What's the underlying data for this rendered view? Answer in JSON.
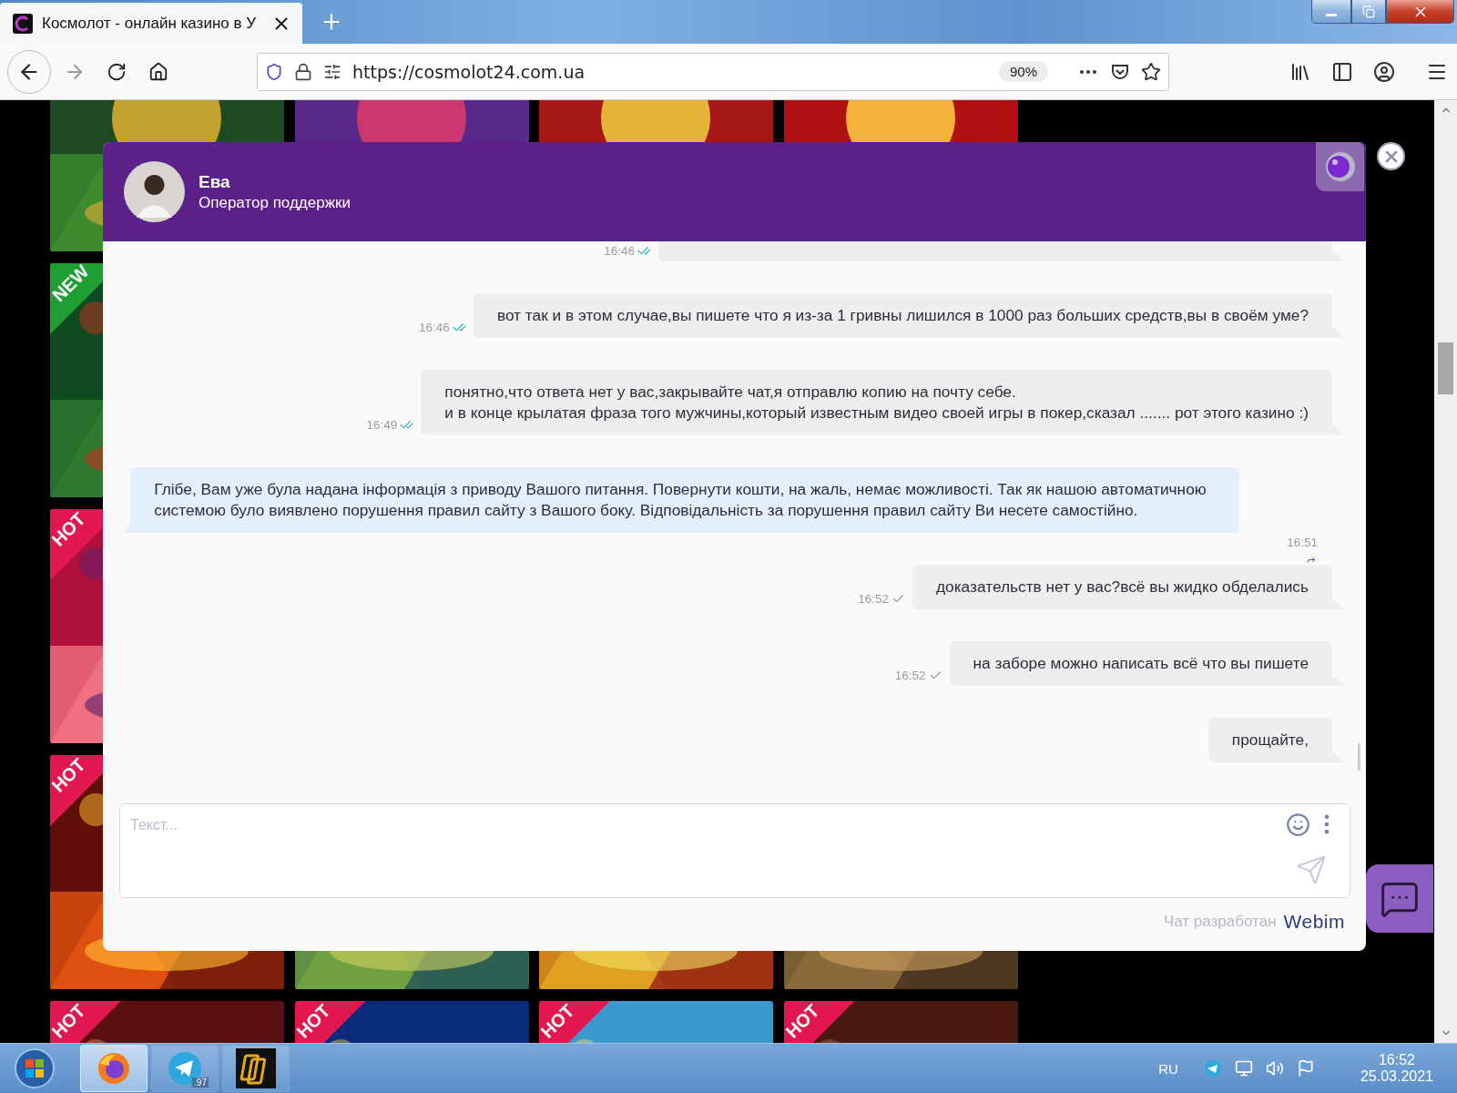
{
  "browser": {
    "tab": {
      "title": "Космолот - онлайн казино в У",
      "selected": true
    },
    "address": {
      "url": "https://cosmolot24.com.ua",
      "zoom": "90%"
    }
  },
  "games": [
    [
      {
        "kind": "picture"
      },
      {
        "kind": "picture"
      },
      {
        "kind": "picture"
      },
      {
        "kind": "picture"
      }
    ],
    [
      {
        "kind": "picture",
        "badge": {
          "text": "NEW",
          "color": "#1f9e34"
        }
      },
      {
        "kind": "covered"
      },
      {
        "kind": "covered"
      },
      {
        "kind": "covered"
      }
    ],
    [
      {
        "kind": "picture",
        "badge": {
          "text": "HOT",
          "color": "#e3174f"
        }
      },
      {
        "kind": "covered"
      },
      {
        "kind": "covered"
      },
      {
        "kind": "covered"
      }
    ],
    [
      {
        "kind": "picture",
        "badge": {
          "text": "HOT",
          "color": "#e3174f"
        }
      },
      {
        "kind": "picture"
      },
      {
        "kind": "picture"
      },
      {
        "kind": "picture"
      }
    ],
    [
      {
        "kind": "picture",
        "badge": {
          "text": "HOT",
          "color": "#e3174f"
        }
      },
      {
        "kind": "picture",
        "badge": {
          "text": "HOT",
          "color": "#e3174f"
        }
      },
      {
        "kind": "picture",
        "badge": {
          "text": "HOT",
          "color": "#e3174f"
        }
      },
      {
        "kind": "picture",
        "badge": {
          "text": "HOT",
          "color": "#e3174f"
        }
      }
    ]
  ],
  "chat": {
    "agent": {
      "name": "Ева",
      "role": "Оператор поддержки"
    },
    "messages": [
      {
        "kind": "outgoing",
        "time": "16:46",
        "read": true
      },
      {
        "kind": "outgoing",
        "lines": [
          "вот так и в этом случае,вы пишете что я из-за 1 гривны лишился в 1000 раз больших средств,вы в своём уме?"
        ],
        "time": "16:46",
        "read": true
      },
      {
        "kind": "outgoing",
        "lines": [
          "понятно,что ответа нет у вас,закрывайте чат,я отправлю копию на почту себе.",
          "и в конце крылатая фраза того мужчины,который известным видео своей игры в покер,сказал ....... рот этого казино :)"
        ],
        "time": "16:49",
        "read": true
      },
      {
        "kind": "incoming",
        "lines": [
          "Глібе, Вам уже була надана інформація з приводу Вашого питання. Повернути кошти, на жаль, немає можливості. Так як нашою автоматичною системою було виявлено порушення правил сайту з Вашого боку. Відповідальність за порушення правил сайту Ви несете самостійно."
        ],
        "time": "16:51"
      },
      {
        "kind": "outgoing",
        "lines": [
          "доказательств нет у вас?всё вы жидко обделались"
        ],
        "time": "16:52",
        "read": false
      },
      {
        "kind": "outgoing",
        "lines": [
          "на заборе можно написать всё что вы пишете"
        ],
        "time": "16:52",
        "read": false
      },
      {
        "kind": "outgoing",
        "lines": [
          "прощайте,"
        ]
      }
    ],
    "composer": {
      "placeholder": "Текст..."
    },
    "credit": {
      "text": "Чат разработан",
      "brand": "Webim"
    }
  },
  "taskbar": {
    "apps": [
      {
        "kind": "firefox",
        "selected": true
      },
      {
        "kind": "telegram",
        "selected": false,
        "badge": ".97"
      },
      {
        "kind": "files",
        "selected": false
      }
    ],
    "language": "RU",
    "time": "16:52",
    "date": "25.03.2021"
  }
}
